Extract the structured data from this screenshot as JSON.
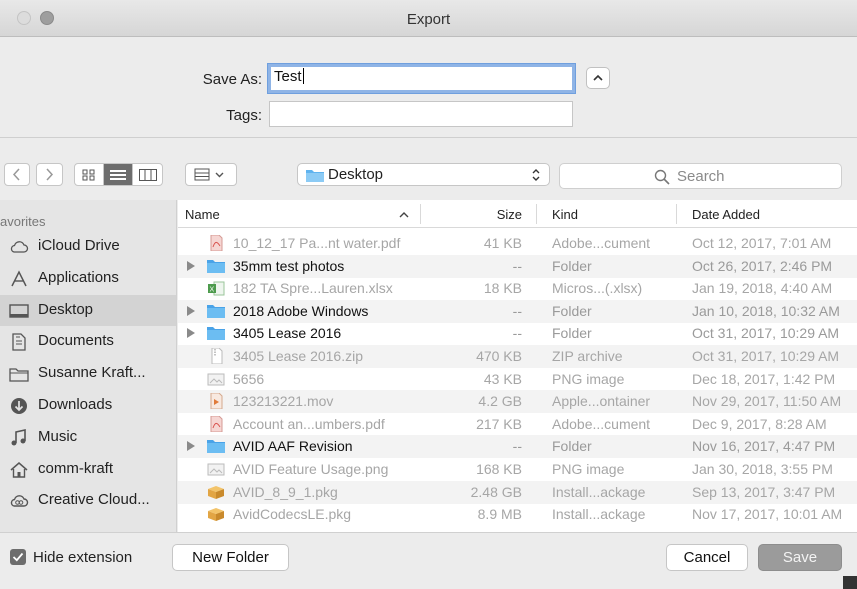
{
  "window": {
    "title": "Export"
  },
  "save_as": {
    "label": "Save As:",
    "value": "Test",
    "tags_label": "Tags:",
    "tags_value": ""
  },
  "toolbar": {
    "location": "Desktop",
    "search_placeholder": "Search"
  },
  "sidebar": {
    "header": "avorites",
    "items": [
      {
        "label": "iCloud Drive",
        "icon": "cloud-icon"
      },
      {
        "label": "Applications",
        "icon": "applications-icon"
      },
      {
        "label": "Desktop",
        "icon": "desktop-icon",
        "selected": true
      },
      {
        "label": "Documents",
        "icon": "documents-icon"
      },
      {
        "label": "Susanne Kraft...",
        "icon": "folder-icon"
      },
      {
        "label": "Downloads",
        "icon": "downloads-icon"
      },
      {
        "label": "Music",
        "icon": "music-icon"
      },
      {
        "label": "comm-kraft",
        "icon": "home-icon"
      },
      {
        "label": "Creative Cloud...",
        "icon": "creative-cloud-icon"
      }
    ]
  },
  "columns": {
    "name": "Name",
    "size": "Size",
    "kind": "Kind",
    "date_added": "Date Added"
  },
  "files": [
    {
      "name": "10_12_17 Pa...nt water.pdf",
      "size": "41 KB",
      "kind": "Adobe...cument",
      "date": "Oct 12, 2017, 7:01 AM",
      "type": "pdf"
    },
    {
      "name": "35mm test photos",
      "size": "--",
      "kind": "Folder",
      "date": "Oct 26, 2017, 2:46 PM",
      "type": "folder"
    },
    {
      "name": "182 TA Spre...Lauren.xlsx",
      "size": "18 KB",
      "kind": "Micros...(.xlsx)",
      "date": "Jan 19, 2018, 4:40 AM",
      "type": "xlsx"
    },
    {
      "name": "2018 Adobe Windows",
      "size": "--",
      "kind": "Folder",
      "date": "Jan 10, 2018, 10:32 AM",
      "type": "folder"
    },
    {
      "name": "3405 Lease 2016",
      "size": "--",
      "kind": "Folder",
      "date": "Oct 31, 2017, 10:29 AM",
      "type": "folder"
    },
    {
      "name": "3405 Lease 2016.zip",
      "size": "470 KB",
      "kind": "ZIP archive",
      "date": "Oct 31, 2017, 10:29 AM",
      "type": "zip"
    },
    {
      "name": "5656",
      "size": "43 KB",
      "kind": "PNG image",
      "date": "Dec 18, 2017, 1:42 PM",
      "type": "png"
    },
    {
      "name": "123213221.mov",
      "size": "4.2 GB",
      "kind": "Apple...ontainer",
      "date": "Nov 29, 2017, 11:50 AM",
      "type": "mov"
    },
    {
      "name": "Account an...umbers.pdf",
      "size": "217 KB",
      "kind": "Adobe...cument",
      "date": "Dec 9, 2017, 8:28 AM",
      "type": "pdf"
    },
    {
      "name": "AVID AAF Revision",
      "size": "--",
      "kind": "Folder",
      "date": "Nov 16, 2017, 4:47 PM",
      "type": "folder"
    },
    {
      "name": "AVID Feature Usage.png",
      "size": "168 KB",
      "kind": "PNG image",
      "date": "Jan 30, 2018, 3:55 PM",
      "type": "png"
    },
    {
      "name": "AVID_8_9_1.pkg",
      "size": "2.48 GB",
      "kind": "Install...ackage",
      "date": "Sep 13, 2017, 3:47 PM",
      "type": "pkg"
    },
    {
      "name": "AvidCodecsLE.pkg",
      "size": "8.9 MB",
      "kind": "Install...ackage",
      "date": "Nov 17, 2017, 10:01 AM",
      "type": "pkg"
    }
  ],
  "bottom": {
    "hide_extension_label": "Hide extension",
    "hide_extension_checked": true,
    "new_folder_label": "New Folder",
    "cancel_label": "Cancel",
    "save_label": "Save"
  },
  "colors": {
    "folder_blue": "#5fb3ef",
    "selection_gray": "#d3d3d3",
    "focus_ring": "#8fb4e6"
  }
}
